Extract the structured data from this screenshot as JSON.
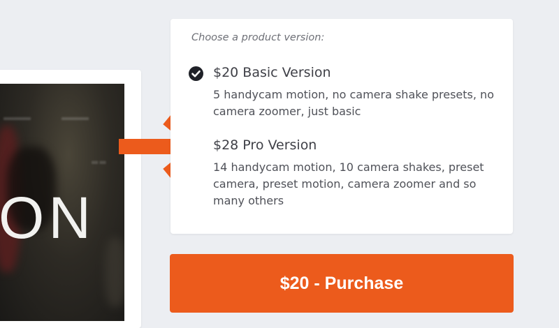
{
  "preview": {
    "title": "ON"
  },
  "options": {
    "prompt": "Choose a product version:",
    "items": [
      {
        "title": "$20 Basic Version",
        "description": "5 handycam motion, no camera shake presets, no camera zoomer, just basic",
        "selected": true
      },
      {
        "title": "$28 Pro Version",
        "description": "14 handycam motion, 10 camera shakes, preset camera, preset motion, camera zoomer and so many others",
        "selected": false
      }
    ]
  },
  "purchase": {
    "label": "$20 - Purchase"
  },
  "colors": {
    "accent": "#ec5b1c",
    "background": "#eceef2",
    "card": "#ffffff",
    "check": "#1f2128",
    "text": "#3f4047"
  },
  "icons": {
    "selected": "check-circle-icon",
    "pointer": "arrow-right-icon",
    "emphasis": "sparkle-lines-icon"
  }
}
